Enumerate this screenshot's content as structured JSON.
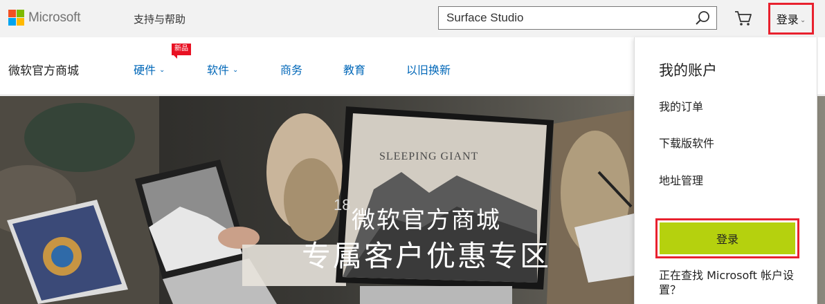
{
  "brand": {
    "name": "Microsoft",
    "logo_colors": [
      "#f25022",
      "#7fba00",
      "#00a4ef",
      "#ffb900"
    ]
  },
  "header": {
    "support_link": "支持与帮助",
    "search": {
      "value": "Surface Studio",
      "icon": "search-icon"
    },
    "cart_icon": "cart-icon",
    "signin_label": "登录",
    "signin_chevron": "⌄"
  },
  "nav": {
    "store_title": "微软官方商城",
    "new_badge": "新品",
    "items": [
      {
        "label": "硬件",
        "has_dropdown": true
      },
      {
        "label": "软件",
        "has_dropdown": true
      },
      {
        "label": "商务",
        "has_dropdown": false
      },
      {
        "label": "教育",
        "has_dropdown": false
      },
      {
        "label": "以旧换新",
        "has_dropdown": false
      }
    ],
    "chevron": "⌄"
  },
  "hero": {
    "line1": "微软官方商城",
    "line2": "专属客户优惠专区",
    "screen_text": "SLEEPING GIANT",
    "screen_number": "18"
  },
  "account_menu": {
    "heading": "我的账户",
    "links": [
      "我的订单",
      "下载版软件",
      "地址管理"
    ],
    "signin_button": "登录",
    "help_text": "正在查找 Microsoft 帐户设置？"
  },
  "colors": {
    "accent_blue": "#0067b8",
    "highlight_red": "#e8212e",
    "signin_green": "#b5d10e",
    "badge_red": "#e81123"
  }
}
